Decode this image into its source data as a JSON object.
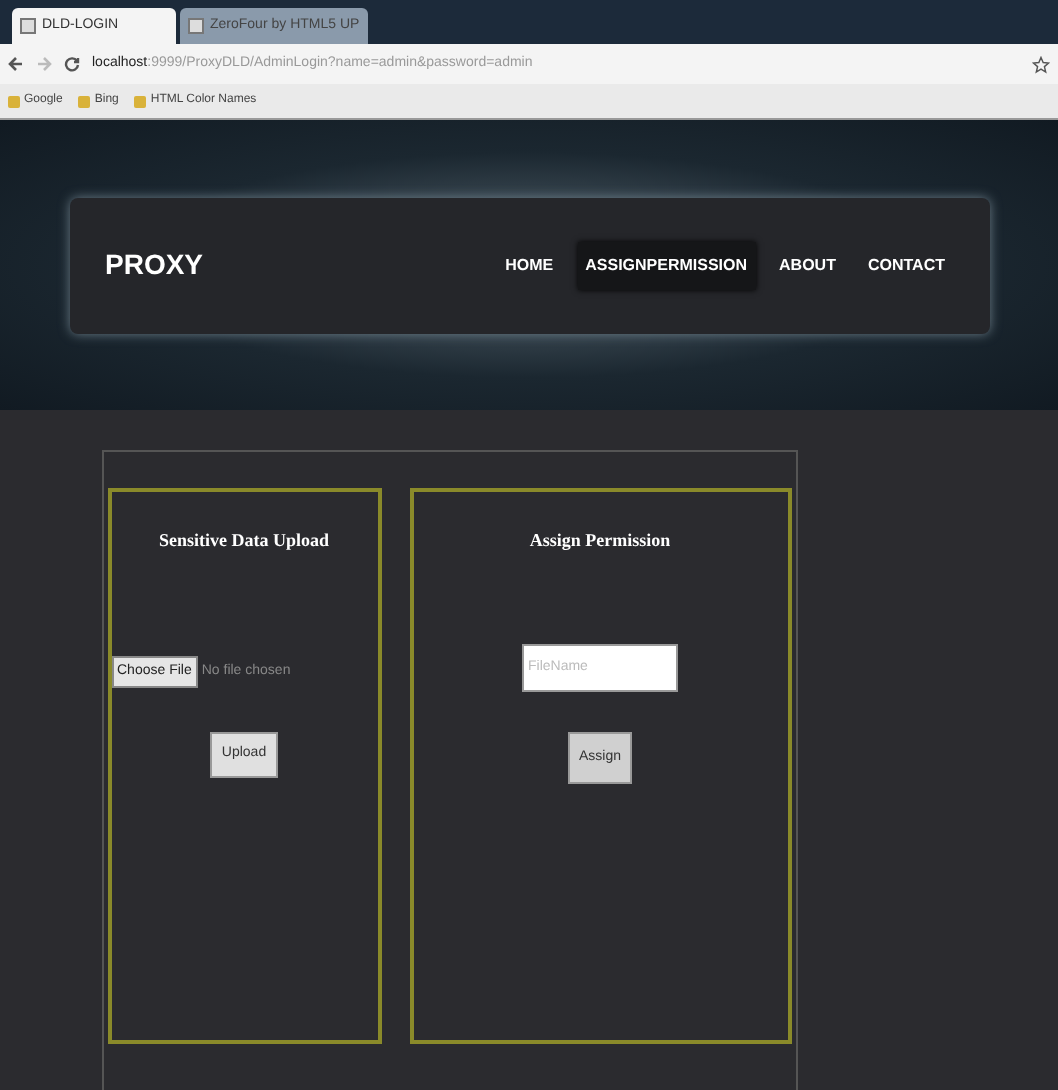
{
  "browser": {
    "tabs": [
      {
        "label": "DLD-LOGIN",
        "selected": true
      },
      {
        "label": "ZeroFour by HTML5 UP",
        "selected": false
      }
    ],
    "address": {
      "host": "localhost",
      "path": ":9999/ProxyDLD/AdminLogin?name=admin&password=admin"
    },
    "bookmarks": [
      "Google",
      "Bing",
      "HTML Color Names"
    ]
  },
  "site": {
    "logo": "PROXY",
    "nav": [
      {
        "label": "HOME",
        "selected": false
      },
      {
        "label": "ASSIGNPERMISSION",
        "selected": true
      },
      {
        "label": "ABOUT",
        "selected": false
      },
      {
        "label": "CONTACT",
        "selected": false
      }
    ]
  },
  "upload_panel": {
    "title": "Sensitive Data Upload",
    "file_button": "Choose File",
    "file_status": "No file chosen",
    "button": "Upload"
  },
  "permission_panel": {
    "title": "Assign Permission",
    "placeholder": "FileName",
    "button": "Assign"
  }
}
